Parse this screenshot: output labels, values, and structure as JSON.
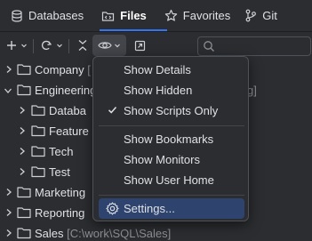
{
  "tabs": [
    {
      "label": "Databases",
      "icon": "database-icon",
      "active": false
    },
    {
      "label": "Files",
      "icon": "folder-code-icon",
      "active": true
    },
    {
      "label": "Favorites",
      "icon": "star-icon",
      "active": false
    },
    {
      "label": "Git",
      "icon": "git-branch-icon",
      "active": false
    }
  ],
  "toolbar": {
    "add_icon": "plus-icon",
    "refresh_icon": "refresh-icon",
    "collapse_icon": "collapse-all-icon",
    "view_icon": "eye-icon",
    "open_icon": "open-in-icon",
    "search_placeholder": ""
  },
  "tree": [
    {
      "label": "Company",
      "path": "[",
      "level": 0,
      "expanded": false
    },
    {
      "label": "Engineering",
      "path": "g]",
      "level": 0,
      "expanded": true
    },
    {
      "label": "Databa",
      "path": "",
      "level": 1,
      "expanded": false
    },
    {
      "label": "Feature",
      "path": "",
      "level": 1,
      "expanded": false
    },
    {
      "label": "Tech",
      "path": "",
      "level": 1,
      "expanded": false
    },
    {
      "label": "Test",
      "path": "",
      "level": 1,
      "expanded": false
    },
    {
      "label": "Marketing",
      "path": "",
      "level": 0,
      "expanded": false
    },
    {
      "label": "Reporting",
      "path": "",
      "level": 0,
      "expanded": false
    },
    {
      "label": "Sales",
      "path": "[C:\\work\\SQL\\Sales]",
      "level": 0,
      "expanded": false
    }
  ],
  "menu": {
    "groups": [
      [
        {
          "label": "Show Details",
          "checked": false
        },
        {
          "label": "Show Hidden",
          "checked": false
        },
        {
          "label": "Show Scripts Only",
          "checked": true
        }
      ],
      [
        {
          "label": "Show Bookmarks",
          "checked": false
        },
        {
          "label": "Show Monitors",
          "checked": false
        },
        {
          "label": "Show User Home",
          "checked": false
        }
      ],
      [
        {
          "label": "Settings...",
          "icon": "gear-icon",
          "selected": true
        }
      ]
    ]
  },
  "colors": {
    "background": "#2b2d30",
    "accent": "#3574f0",
    "selection": "#2e436e",
    "folder": "#ced0d6",
    "text": "#dfe1e5",
    "muted": "#8c8f94"
  }
}
